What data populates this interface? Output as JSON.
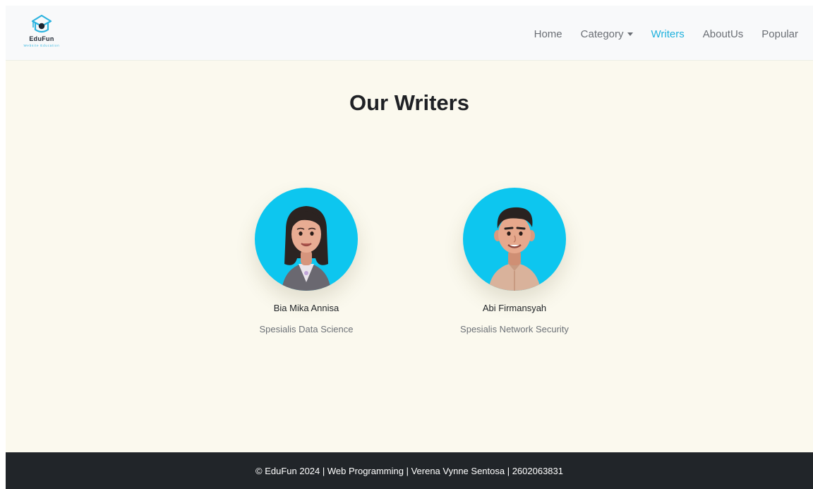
{
  "brand": {
    "name": "EduFun",
    "tagline": "Website Education",
    "accent": "#1fb1dd"
  },
  "nav": {
    "items": [
      {
        "label": "Home",
        "active": false
      },
      {
        "label": "Category",
        "active": false,
        "dropdown": true
      },
      {
        "label": "Writers",
        "active": true
      },
      {
        "label": "AboutUs",
        "active": false
      },
      {
        "label": "Popular",
        "active": false
      }
    ]
  },
  "main": {
    "title": "Our Writers",
    "writers": [
      {
        "name": "Bia Mika Annisa",
        "role": "Spesialis Data Science",
        "avatar": "female-3d-avatar-icon"
      },
      {
        "name": "Abi Firmansyah",
        "role": "Spesialis Network Security",
        "avatar": "male-3d-avatar-icon"
      }
    ]
  },
  "footer": {
    "text": "© EduFun 2024 | Web Programming | Verena Vynne Sentosa | 2602063831"
  },
  "colors": {
    "page_bg": "#fbf9ee",
    "navbar_bg": "#f8f9fa",
    "avatar_bg": "#0dc6ef",
    "footer_bg": "#212529"
  }
}
